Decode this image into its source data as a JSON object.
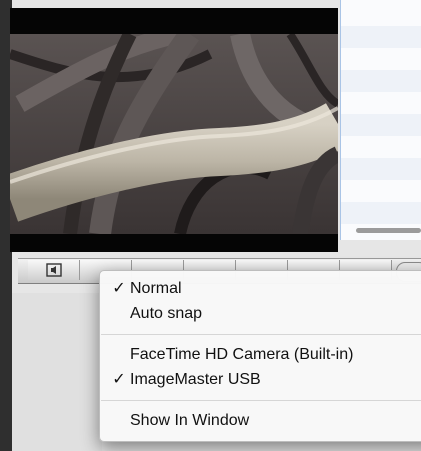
{
  "menu": {
    "items": [
      {
        "label": "Normal",
        "checked": "✓"
      },
      {
        "label": "Auto snap",
        "checked": ""
      },
      {
        "label": "FaceTime HD Camera (Built-in)",
        "checked": ""
      },
      {
        "label": "ImageMaster USB",
        "checked": "✓"
      },
      {
        "label": "Show In Window",
        "checked": ""
      }
    ]
  },
  "toolbar": {
    "buttons": [
      "speaker-icon",
      "button-2",
      "button-3",
      "button-4",
      "button-5",
      "button-6",
      "button-7"
    ]
  },
  "colors": {
    "menu_bg": "#f8f8f8",
    "selection_border": "#a9c4e6",
    "video_bg": "#050505"
  }
}
